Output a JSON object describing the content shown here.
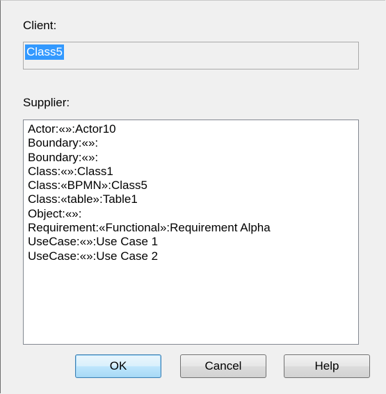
{
  "client": {
    "label": "Client:",
    "value": "Class5"
  },
  "supplier": {
    "label": "Supplier:",
    "items": [
      "Actor:«»:Actor10",
      "Boundary:«»:",
      "Boundary:«»:",
      "Class:«»:Class1",
      "Class:«BPMN»:Class5",
      "Class:«table»:Table1",
      "Object:«»:",
      "Requirement:«Functional»:Requirement Alpha",
      "UseCase:«»:Use Case 1",
      "UseCase:«»:Use Case 2"
    ]
  },
  "buttons": {
    "ok": "OK",
    "cancel": "Cancel",
    "help": "Help"
  }
}
